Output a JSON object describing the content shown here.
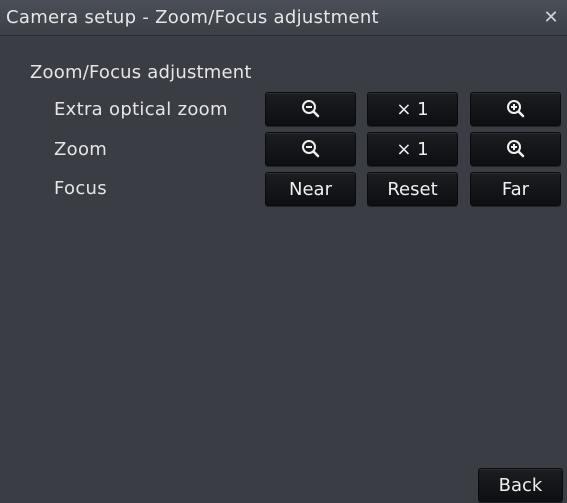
{
  "window": {
    "title": "Camera setup - Zoom/Focus adjustment",
    "close_icon": "close-icon"
  },
  "section": {
    "title": "Zoom/Focus adjustment"
  },
  "rows": [
    {
      "label": "Extra optical zoom",
      "buttons": [
        {
          "icon": "zoom-out-icon"
        },
        {
          "label": "× 1"
        },
        {
          "icon": "zoom-in-icon"
        }
      ]
    },
    {
      "label": "Zoom",
      "buttons": [
        {
          "icon": "zoom-out-icon"
        },
        {
          "label": "× 1"
        },
        {
          "icon": "zoom-in-icon"
        }
      ]
    },
    {
      "label": "Focus",
      "buttons": [
        {
          "label": "Near"
        },
        {
          "label": "Reset"
        },
        {
          "label": "Far"
        }
      ]
    }
  ],
  "footer": {
    "back_label": "Back"
  },
  "colors": {
    "window_bg": "#3a3e44",
    "button_bg": "#111316",
    "text": "#e6e6e6"
  }
}
